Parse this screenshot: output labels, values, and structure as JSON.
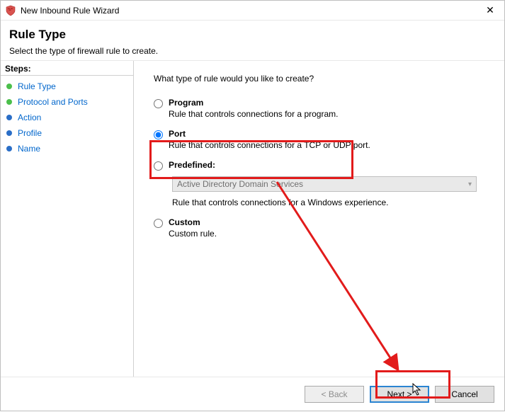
{
  "window": {
    "title": "New Inbound Rule Wizard"
  },
  "header": {
    "title": "Rule Type",
    "subtitle": "Select the type of firewall rule to create."
  },
  "steps": {
    "label": "Steps:",
    "items": [
      {
        "label": "Rule Type"
      },
      {
        "label": "Protocol and Ports"
      },
      {
        "label": "Action"
      },
      {
        "label": "Profile"
      },
      {
        "label": "Name"
      }
    ]
  },
  "content": {
    "question": "What type of rule would you like to create?",
    "options": {
      "program": {
        "label": "Program",
        "desc": "Rule that controls connections for a program."
      },
      "port": {
        "label": "Port",
        "desc": "Rule that controls connections for a TCP or UDP port."
      },
      "predefined": {
        "label": "Predefined:",
        "desc": "Rule that controls connections for a Windows experience.",
        "selected_value": "Active Directory Domain Services"
      },
      "custom": {
        "label": "Custom",
        "desc": "Custom rule."
      }
    }
  },
  "footer": {
    "back": "< Back",
    "next": "Next >",
    "cancel": "Cancel"
  },
  "annotations": {
    "highlight_color": "#e21b1b"
  }
}
